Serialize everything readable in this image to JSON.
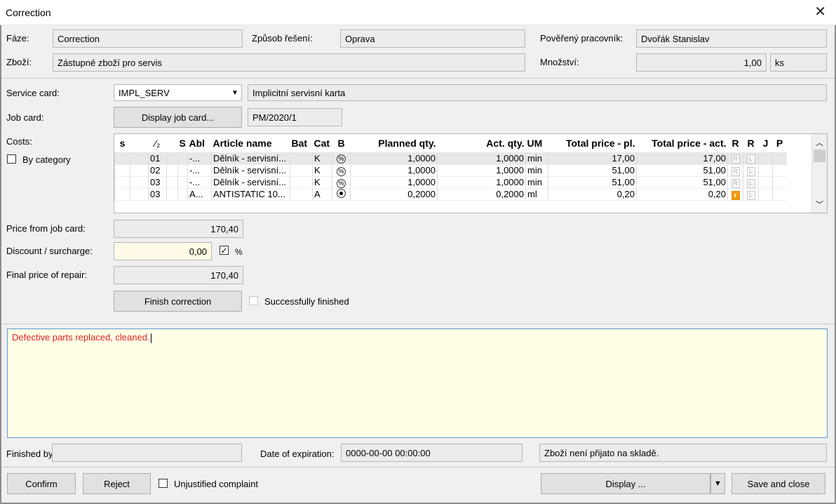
{
  "window": {
    "title": "Correction"
  },
  "header": {
    "faze_label": "Fáze:",
    "faze_value": "Correction",
    "zpusob_label": "Způsob řešení:",
    "zpusob_value": "Oprava",
    "povereny_label": "Pověřený pracovník:",
    "povereny_value": "Dvořák Stanislav",
    "zbozi_label": "Zboží:",
    "zbozi_value": "Zástupné zboží pro servis",
    "mnozstvi_label": "Množství:",
    "mnozstvi_value": "1,00",
    "mnozstvi_unit": "ks"
  },
  "service": {
    "service_card_label": "Service card:",
    "service_card_value": "IMPL_SERV",
    "service_card_desc": "Implicitní servisní karta",
    "job_card_label": "Job card:",
    "job_card_button": "Display job card...",
    "job_card_value": "PM/2020/1",
    "costs_label": "Costs:",
    "by_category_label": "By category"
  },
  "grid": {
    "columns": [
      "s",
      "⁄₂",
      "S",
      "Abl",
      "Article name",
      "Bat",
      "Cat",
      "B",
      "Planned qty.",
      "Act. qty.",
      "UM",
      "Total price - pl.",
      "Total price - act.",
      "R",
      "R",
      "J",
      "P"
    ],
    "rows": [
      {
        "col2": "01",
        "abl": "-...",
        "name": "Dělník - servisní...",
        "cat": "K",
        "b": "%",
        "planned": "1,0000",
        "actual": "1,0000",
        "um": "min",
        "total_pl": "17,00",
        "total_act": "17,00",
        "r1": "R",
        "r2": "L"
      },
      {
        "col2": "02",
        "abl": "-...",
        "name": "Dělník - servisní...",
        "cat": "K",
        "b": "%",
        "planned": "1,0000",
        "actual": "1,0000",
        "um": "min",
        "total_pl": "51,00",
        "total_act": "51,00",
        "r1": "R",
        "r2": "L"
      },
      {
        "col2": "03",
        "abl": "-...",
        "name": "Dělník - servisní...",
        "cat": "K",
        "b": "%",
        "planned": "1,0000",
        "actual": "1,0000",
        "um": "min",
        "total_pl": "51,00",
        "total_act": "51,00",
        "r1": "R",
        "r2": "L"
      },
      {
        "col2": "03",
        "abl": "A...",
        "name": "ANTISTATIC 10...",
        "cat": "A",
        "b": "•",
        "planned": "0,2000",
        "actual": "0,2000",
        "um": "ml",
        "total_pl": "0,20",
        "total_act": "0,20",
        "r1": "r",
        "r2": "L"
      }
    ]
  },
  "pricing": {
    "price_from_job_card_label": "Price from job card:",
    "price_from_job_card_value": "170,40",
    "discount_label": "Discount / surcharge:",
    "discount_value": "0,00",
    "percent_label": "%",
    "final_price_label": "Final price of repair:",
    "final_price_value": "170,40",
    "finish_button": "Finish correction",
    "successfully_finished_label": "Successfully finished"
  },
  "note": {
    "text": "Defective parts replaced, cleaned."
  },
  "bottom": {
    "finished_by_label": "Finished by",
    "finished_by_value": "",
    "date_expiration_label": "Date of expiration:",
    "date_expiration_value": "0000-00-00 00:00:00",
    "status_text": "Zboží není přijato na skladě."
  },
  "footer": {
    "confirm": "Confirm",
    "reject": "Reject",
    "unjustified_label": "Unjustified complaint",
    "display": "Display ...",
    "save_close": "Save and close"
  }
}
